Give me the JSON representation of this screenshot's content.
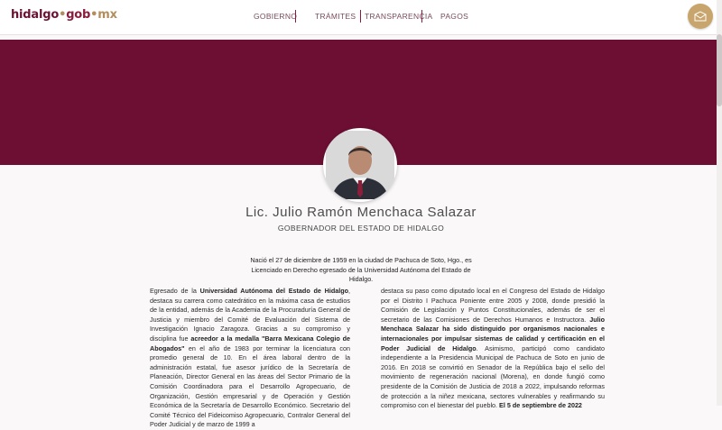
{
  "header": {
    "logo": {
      "part1": "hidalgo",
      "dot1": "•",
      "part2": "gob",
      "dot2": "•",
      "part3": "mx"
    },
    "nav": [
      {
        "label": "GOBIERNO"
      },
      {
        "label": "TRÁMITES"
      },
      {
        "label": "TRANSPARENCIA"
      },
      {
        "label": "PAGOS"
      }
    ],
    "mail_icon": "envelope-icon"
  },
  "profile": {
    "name": "Lic. Julio Ramón Menchaca Salazar",
    "role": "GOBERNADOR DEL ESTADO DE HIDALGO",
    "intro": "Nació el 27 de diciembre de 1959 en la ciudad de Pachuca de Soto, Hgo., es Licenciado en Derecho egresado de la Universidad Autónoma del Estado de Hidalgo."
  },
  "bio": {
    "left": {
      "t1": "Egresado de la ",
      "b1": "Universidad Autónoma del Estado de Hidalgo",
      "t2": ", destaca su carrera como catedrático en la máxima casa de estudios de la entidad, además de la Academia de la Procuraduría General de Justicia y miembro del Comité de Evaluación del Sistema de Investigación Ignacio Zaragoza. Gracias a su compromiso y disciplina fue ",
      "b2": "acreedor a la medalla \"Barra Mexicana Colegio de Abogados\"",
      "t3": " en el año de 1983 por terminar la licenciatura con promedio general de 10. En el área laboral dentro de la administración estatal, fue asesor jurídico de la Secretaría de Planeación, Director General en las áreas del Sector Primario de la Comisión Coordinadora para el Desarrollo Agropecuario, de Organización, Gestión empresarial y de Operación y Gestión Económica de la Secretaría de Desarrollo Económico. Secretario del Comité Técnico del Fideicomiso Agropecuario, Contralor General del Poder Judicial y de marzo de 1999 a"
    },
    "right": {
      "t1": "destaca su paso como diputado local en el Congreso del Estado de Hidalgo por el Distrito I Pachuca Poniente entre 2005 y 2008, donde presidió la Comisión de Legislación y Puntos Constitucionales, además de ser el secretario de las Comisiones de Derechos Humanos e Instructora. ",
      "b1": "Julio Menchaca Salazar ha sido distinguido por organismos nacionales e internacionales por impulsar sistemas de calidad y certificación en el Poder Judicial de Hidalgo",
      "t2": ". Asimismo, participó como candidato independiente a la Presidencia Municipal de Pachuca de Soto en junio de 2016. En 2018 se convirtió en Senador de la República bajo el sello del movimiento de regeneración nacional (Morena), en donde fungió como presidente de la Comisión de Justicia de 2018 a 2022, impulsando reformas de protección a la niñez mexicana, sectores vulnerables y reafirmando su compromiso con el bienestar del pueblo. ",
      "b2": "El 5 de septiembre de 2022"
    }
  },
  "colors": {
    "banner": "#6d0f33",
    "gold": "#c9a56e",
    "nav_text": "#7a4a5a"
  }
}
